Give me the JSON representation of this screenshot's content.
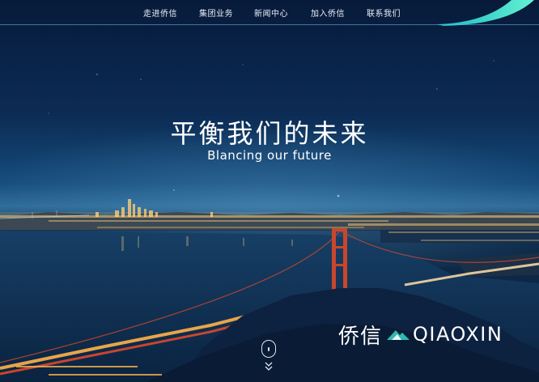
{
  "nav": {
    "items": [
      {
        "label": "走进侨信"
      },
      {
        "label": "集团业务"
      },
      {
        "label": "新闻中心"
      },
      {
        "label": "加入侨信"
      },
      {
        "label": "联系我们"
      }
    ]
  },
  "hero": {
    "title": "平衡我们的未来",
    "subtitle": "Blancing our future"
  },
  "brand": {
    "name_cn": "侨信",
    "name_en": "QIAOXIN"
  },
  "icons": {
    "scroll": "mouse-scroll-icon",
    "down": "double-chevron-down-icon",
    "logo": "mountain-logo-icon"
  },
  "colors": {
    "accent": "#2fd6c9",
    "sky_top": "#071a3a",
    "city_light": "#ffcf7a",
    "bridge": "#c8462d"
  }
}
